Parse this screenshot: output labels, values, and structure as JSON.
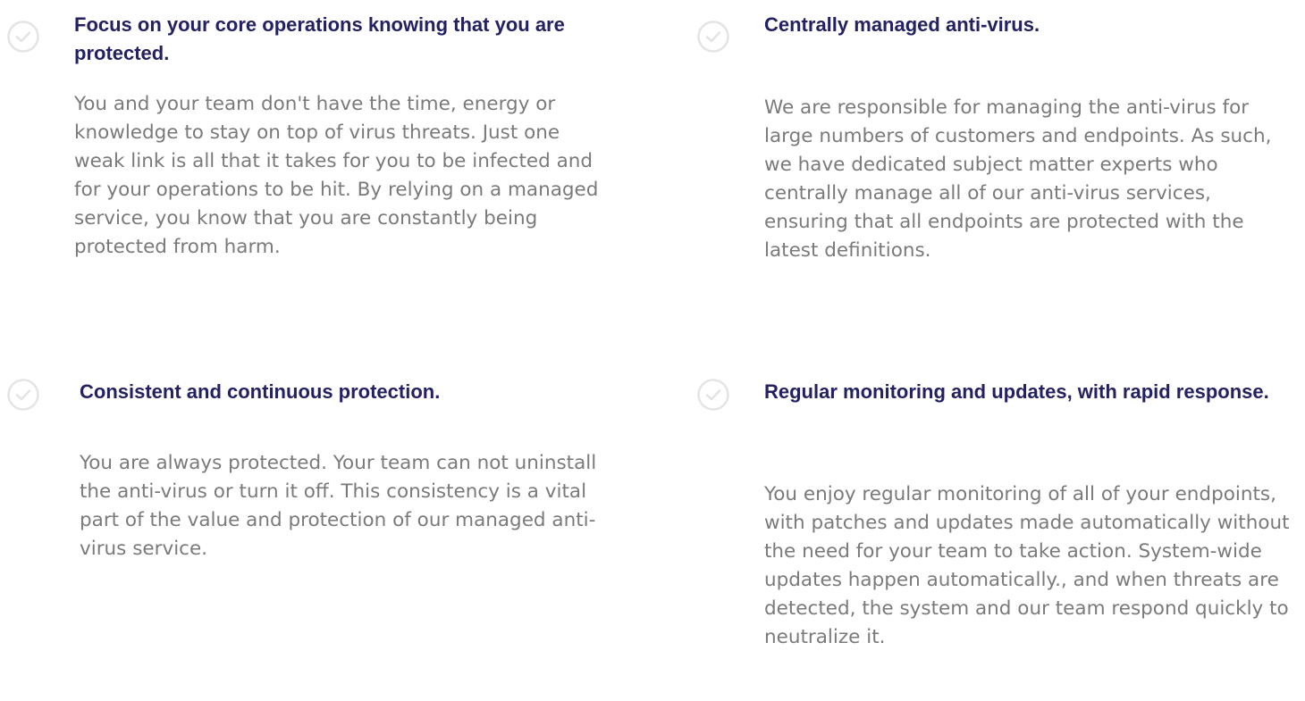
{
  "features": [
    {
      "title": "Focus on your core operations knowing that you are protected.",
      "body": "You and your team don't have the time, energy or knowledge to stay on top of virus threats. Just one weak link is all that it takes for you to be infected and for your operations to be hit. By relying on a managed service, you know that you are constantly being protected from harm.",
      "icon": "check-circle-icon"
    },
    {
      "title": "Centrally managed anti-virus.",
      "body": "We are responsible for managing the anti-virus for large numbers of customers and endpoints. As such, we have dedicated subject matter experts who centrally manage all of our anti-virus services, ensuring that all endpoints are protected with the latest definitions.",
      "icon": "check-circle-icon"
    },
    {
      "title": "Consistent and continuous protection.",
      "body": "You are always protected. Your team can not uninstall the anti-virus or turn it off. This consistency is a vital part of the value and protection of our managed anti-virus service.",
      "icon": "check-circle-icon"
    },
    {
      "title": "Regular monitoring and updates, with rapid response.",
      "body": "You enjoy regular monitoring of all of your endpoints, with patches and updates made automatically without the need for your team to take action. System-wide updates happen automatically., and when threats are detected, the system and our team respond quickly to neutralize it.",
      "icon": "check-circle-icon"
    }
  ],
  "colors": {
    "title": "#232161",
    "body": "#7a7a7a",
    "icon": "#e4e4e4"
  }
}
